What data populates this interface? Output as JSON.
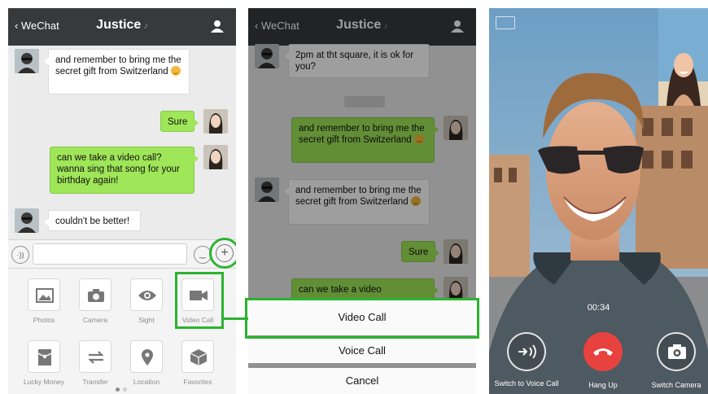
{
  "colors": {
    "header": "#37393b",
    "chat_bg": "#ebebeb",
    "bubble_green": "#9fe658",
    "highlight": "#2ab32f",
    "hangup": "#e8423f"
  },
  "panel1": {
    "header": {
      "back": "WeChat",
      "title": "Justice"
    },
    "messages": [
      {
        "from": "contact",
        "text": "and remember to bring me the  secret gift from Switzerland"
      },
      {
        "from": "me",
        "text": "Sure"
      },
      {
        "from": "me",
        "text": "can we take a video call?wanna sing that song for your birthday again!"
      },
      {
        "from": "contact",
        "text": "couldn't be better!"
      }
    ],
    "input": {
      "value": ""
    },
    "tools": [
      {
        "label": "Photos",
        "icon": "photo-icon"
      },
      {
        "label": "Camera",
        "icon": "camera-icon"
      },
      {
        "label": "Sight",
        "icon": "eye-icon"
      },
      {
        "label": "Video Call",
        "icon": "video-camera-icon"
      },
      {
        "label": "Lucky Money",
        "icon": "red-packet-icon"
      },
      {
        "label": "Transfer",
        "icon": "transfer-icon"
      },
      {
        "label": "Location",
        "icon": "location-pin-icon"
      },
      {
        "label": "Favorites",
        "icon": "cube-icon"
      }
    ]
  },
  "panel2": {
    "header": {
      "back": "WeChat",
      "title": "Justice"
    },
    "messages": [
      {
        "from": "contact",
        "text": "2pm at tht square, it is ok for you?"
      },
      {
        "from": "me",
        "text": "and remember to bring me the  secret gift from Switzerland"
      },
      {
        "from": "contact",
        "text": "and remember to bring me the  secret gift from Switzerland"
      },
      {
        "from": "me",
        "text": "Sure"
      },
      {
        "from": "me",
        "text": "can we take a video"
      }
    ],
    "action_sheet": {
      "video_call": "Video Call",
      "voice_call": "Voice Call",
      "cancel": "Cancel"
    }
  },
  "panel3": {
    "timer": "00:34",
    "buttons": {
      "voice": "Switch to Voice Call",
      "hangup": "Hang Up",
      "camera": "Switch Camera"
    }
  }
}
